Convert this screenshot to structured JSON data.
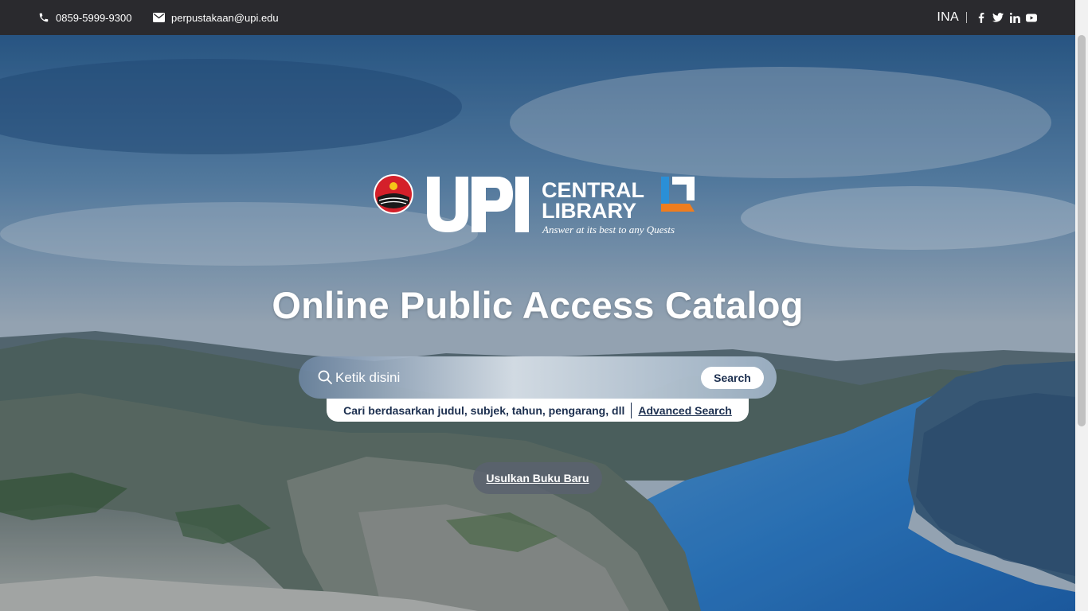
{
  "topbar": {
    "phone": "0859-5999-9300",
    "email": "perpustakaan@upi.edu",
    "language": "INA",
    "social_icons": [
      "facebook-icon",
      "twitter-icon",
      "linkedin-icon",
      "youtube-icon"
    ]
  },
  "logo": {
    "brand": "UPI",
    "line1": "CENTRAL",
    "line2": "LIBRARY",
    "tagline": "Answer at its best to any Quests",
    "colors": {
      "orange": "#ee7d1f",
      "blue": "#2a8fd6",
      "emblem_red": "#d4202a"
    }
  },
  "hero": {
    "title": "Online Public Access Catalog"
  },
  "search": {
    "placeholder": "Ketik disini",
    "button_label": "Search",
    "hint": "Cari berdasarkan judul, subjek, tahun, pengarang, dll",
    "advanced_label": "Advanced Search"
  },
  "suggest": {
    "label": "Usulkan Buku Baru"
  },
  "colors": {
    "topbar_bg": "#2a2a2e",
    "accent_text": "#1c2f4f"
  }
}
